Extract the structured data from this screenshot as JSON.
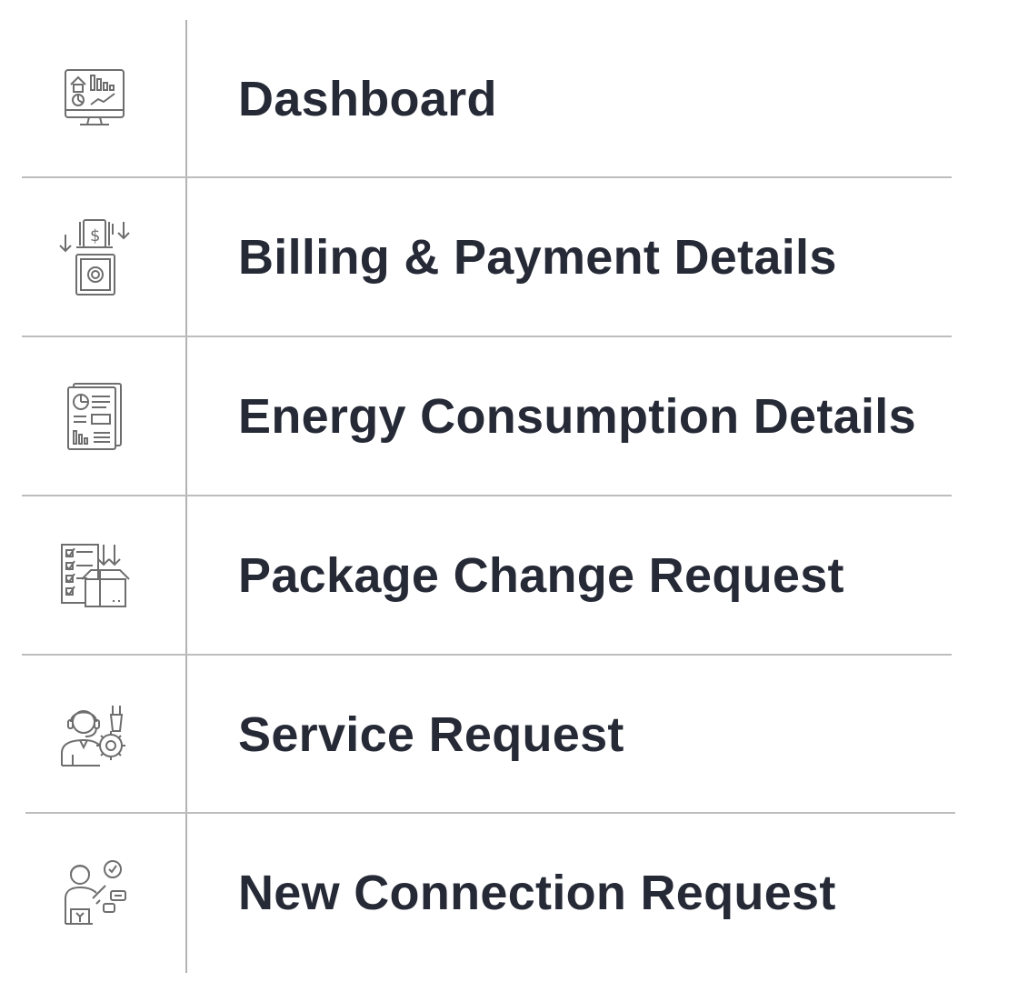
{
  "menu": {
    "items": [
      {
        "label": "Dashboard",
        "icon": "dashboard-monitor-icon"
      },
      {
        "label": "Billing & Payment Details",
        "icon": "billing-safe-icon"
      },
      {
        "label": "Energy Consumption Details",
        "icon": "consumption-report-icon"
      },
      {
        "label": "Package Change Request",
        "icon": "package-checklist-icon"
      },
      {
        "label": "Service Request",
        "icon": "service-support-icon"
      },
      {
        "label": "New Connection Request",
        "icon": "new-connection-icon"
      }
    ]
  },
  "colors": {
    "text": "#262a36",
    "icon_stroke": "#6e6e6e",
    "divider": "#bdbdbd",
    "background": "#ffffff"
  }
}
